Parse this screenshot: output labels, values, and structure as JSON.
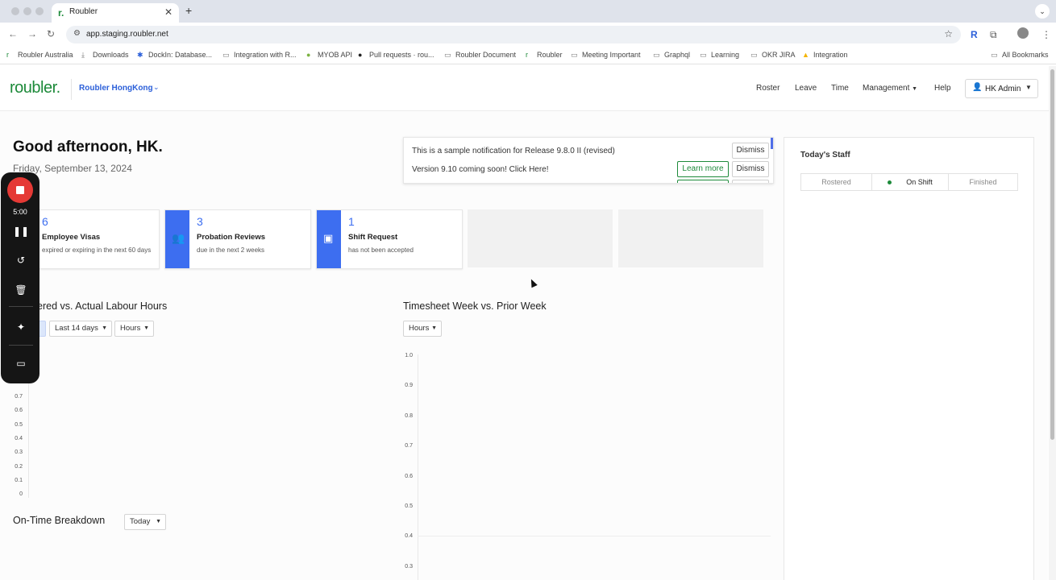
{
  "browser": {
    "tab_title": "Roubler",
    "tab_favicon": "r.",
    "new_tab_icon": "+",
    "url": "app.staging.roubler.net",
    "bookmarks": [
      {
        "label": "Roubler Australia",
        "icon": "roubler-icon"
      },
      {
        "label": "Downloads",
        "icon": "download-icon"
      },
      {
        "label": "DockIn: Database...",
        "icon": "dockin-icon"
      },
      {
        "label": "Integration with R...",
        "icon": "folder-icon"
      },
      {
        "label": "MYOB API",
        "icon": "myob-icon"
      },
      {
        "label": "Pull requests · rou...",
        "icon": "github-icon"
      },
      {
        "label": "Roubler Document",
        "icon": "folder-icon"
      },
      {
        "label": "Roubler",
        "icon": "roubler-icon"
      },
      {
        "label": "Meeting Important",
        "icon": "folder-icon"
      },
      {
        "label": "Graphql",
        "icon": "folder-icon"
      },
      {
        "label": "Learning",
        "icon": "folder-icon"
      },
      {
        "label": "OKR JIRA",
        "icon": "folder-icon"
      },
      {
        "label": "Integration",
        "icon": "drive-icon"
      }
    ],
    "all_bookmarks": "All Bookmarks"
  },
  "header": {
    "logo": "roubler.",
    "org": "Roubler HongKong",
    "nav": [
      "Roster",
      "Leave",
      "Time",
      "Management",
      "Help"
    ],
    "user": "HK Admin"
  },
  "dashboard": {
    "greeting": "Good afternoon, HK.",
    "date": "Friday, September 13, 2024"
  },
  "notifications": [
    {
      "text": "This is a sample notification for Release 9.8.0 II (revised)",
      "dismiss": "Dismiss"
    },
    {
      "text": "Version 9.10 coming soon! Click Here!",
      "learn_more": "Learn more",
      "dismiss": "Dismiss"
    }
  ],
  "cards": [
    {
      "count": "6",
      "title": "Employee Visas",
      "subtitle": "expired or expiring in the next 60 days",
      "icon": "passport-icon"
    },
    {
      "count": "3",
      "title": "Probation Reviews",
      "subtitle": "due in the next 2 weeks",
      "icon": "people-icon"
    },
    {
      "count": "1",
      "title": "Shift Request",
      "subtitle": "has not been accepted",
      "icon": "shift-card-icon"
    }
  ],
  "charts": {
    "labour": {
      "title": "ered vs. Actual Labour Hours",
      "range": "Last 14 days",
      "unit": "Hours"
    },
    "timesheet": {
      "title": "Timesheet Week vs. Prior Week",
      "unit": "Hours"
    },
    "ontime": {
      "title": "On-Time Breakdown",
      "range": "Today"
    }
  },
  "chart_data": [
    {
      "type": "line",
      "title": "ered vs. Actual Labour Hours",
      "y_ticks": [
        "0.7",
        "0.6",
        "0.5",
        "0.4",
        "0.3",
        "0.2",
        "0.1",
        "0"
      ],
      "ylim": [
        0,
        0.7
      ],
      "series": []
    },
    {
      "type": "line",
      "title": "Timesheet Week vs. Prior Week",
      "y_ticks": [
        "1.0",
        "0.9",
        "0.8",
        "0.7",
        "0.6",
        "0.5",
        "0.4",
        "0.3"
      ],
      "ylim": [
        0.3,
        1.0
      ],
      "series": []
    }
  ],
  "staff": {
    "title": "Today's Staff",
    "segments": [
      "Rostered",
      "On Shift",
      "Finished"
    ],
    "active": "On Shift"
  },
  "recorder": {
    "time": "5:00"
  }
}
